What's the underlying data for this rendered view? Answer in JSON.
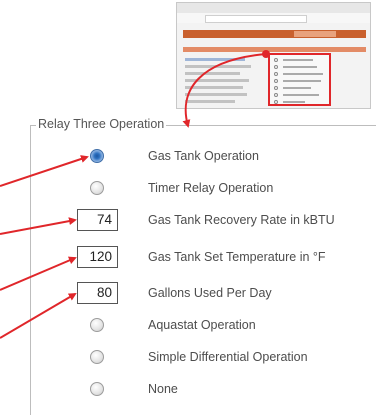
{
  "group": {
    "legend": "Relay Three Operation"
  },
  "options": [
    {
      "type": "radio",
      "label": "Gas Tank Operation",
      "checked": true
    },
    {
      "type": "radio",
      "label": "Timer Relay Operation",
      "checked": false
    },
    {
      "type": "number",
      "label": "Gas Tank Recovery Rate in kBTU",
      "value": "74"
    },
    {
      "type": "number",
      "label": "Gas Tank Set Temperature in °F",
      "value": "120"
    },
    {
      "type": "number",
      "label": "Gallons Used Per Day",
      "value": "80"
    },
    {
      "type": "radio",
      "label": "Aquastat Operation",
      "checked": false
    },
    {
      "type": "radio",
      "label": "Simple Differential Operation",
      "checked": false
    },
    {
      "type": "radio",
      "label": "None",
      "checked": false
    }
  ],
  "colors": {
    "callout": "#e0262a",
    "accent_orange": "#c9602d",
    "radio_selected": "#2a6fbf"
  }
}
